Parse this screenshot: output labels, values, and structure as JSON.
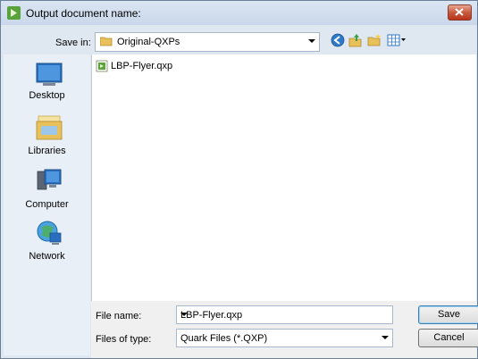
{
  "dialog": {
    "title": "Output document name:"
  },
  "toolbar": {
    "save_in_label": "Save in:",
    "save_in_value": "Original-QXPs",
    "icons": [
      "back-icon",
      "up-folder-icon",
      "new-folder-icon",
      "view-menu-icon"
    ]
  },
  "places": [
    {
      "label": "Desktop",
      "icon": "desktop-icon"
    },
    {
      "label": "Libraries",
      "icon": "libraries-icon"
    },
    {
      "label": "Computer",
      "icon": "computer-icon"
    },
    {
      "label": "Network",
      "icon": "network-icon"
    }
  ],
  "files": [
    {
      "name": "LBP-Flyer.qxp",
      "icon": "qxp-file-icon"
    }
  ],
  "form": {
    "file_name_label": "File name:",
    "file_name_value": "LBP-Flyer.qxp",
    "file_type_label": "Files of type:",
    "file_type_value": "Quark Files (*.QXP)",
    "save_label": "Save",
    "cancel_label": "Cancel"
  },
  "colors": {
    "titlebar": "#c9d7ea",
    "close_button": "#c75a3e",
    "dialog_bg": "#dfe7f1"
  }
}
